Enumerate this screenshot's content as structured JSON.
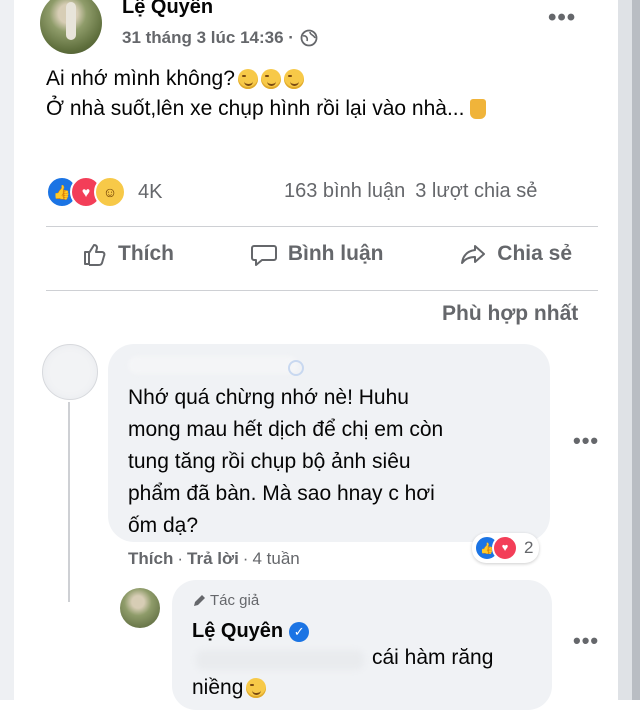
{
  "post": {
    "author": "Lệ Quyên",
    "meta": "31 tháng 3 lúc 14:36 ·",
    "more_icon": "more-horizontal-icon",
    "text_line1": "Ai nhớ mình không?",
    "text_line2": "Ở nhà suốt,lên xe chụp hình rồi lại vào nhà...",
    "reaction_count": "4K",
    "comments_count": "163 bình luận",
    "shares_count": "3 lượt chia sẻ"
  },
  "actions": {
    "like": "Thích",
    "comment": "Bình luận",
    "share": "Chia sẻ"
  },
  "sort_label": "Phù hợp nhất",
  "comment": {
    "text": "Nhớ quá chừng nhớ nè! Huhu\nmong mau hết dịch để chị em còn\ntung tăng rồi chụp bộ ảnh siêu\nphẩm đã bàn. Mà sao hnay c hơi\nốm dạ?",
    "like": "Thích",
    "sep1": "·",
    "reply": "Trả lời",
    "sep2": "·",
    "time": "4 tuần",
    "reaction_count": "2"
  },
  "reply": {
    "badge": "Tác giả",
    "author": "Lệ Quyên",
    "text_part1": "cái hàm răng",
    "text_part2": "niềng"
  },
  "colors": {
    "like_blue": "#1b74e4",
    "love_red": "#f33e58",
    "haha_yellow": "#f7c948",
    "secondary_text": "#65676b",
    "bubble_bg": "#f0f2f5"
  }
}
